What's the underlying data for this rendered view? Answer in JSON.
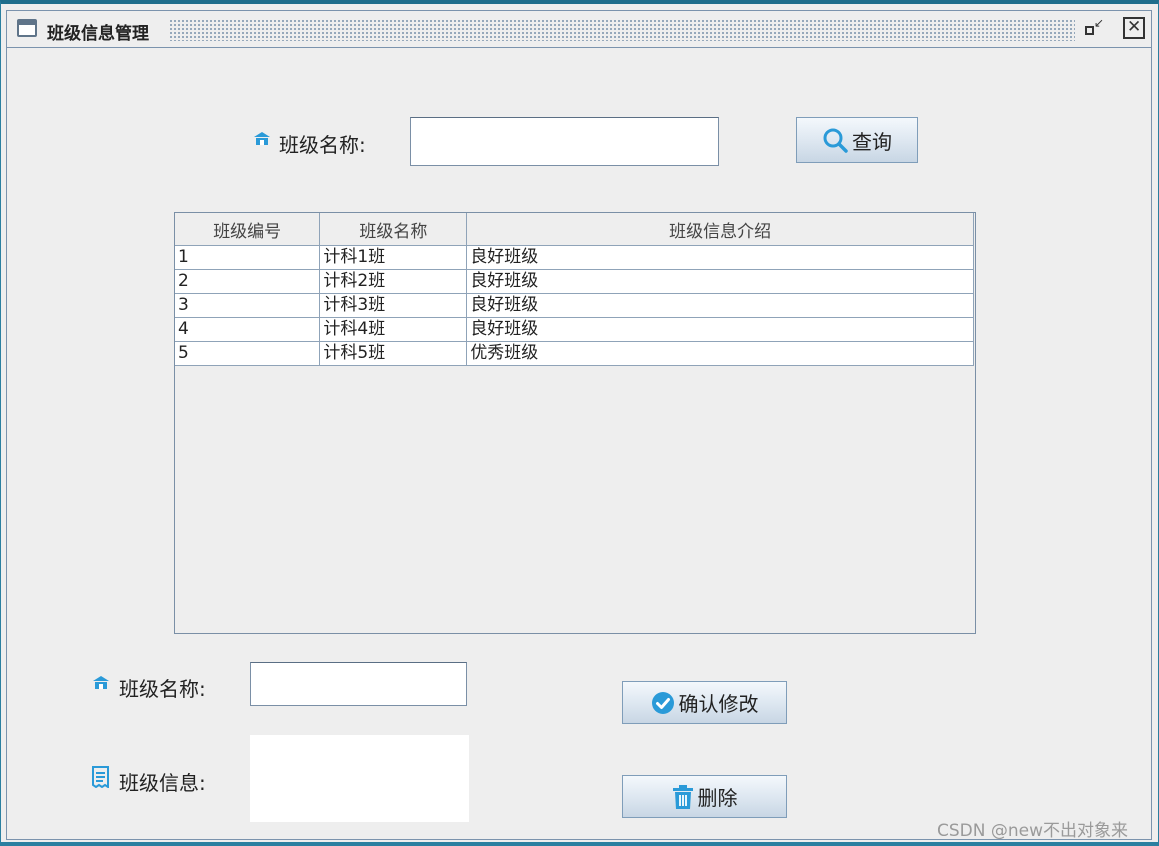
{
  "window": {
    "title": "班级信息管理",
    "restore_icon": "restore-icon",
    "close_icon": "close-icon"
  },
  "search": {
    "label": "班级名称:",
    "icon": "building-icon",
    "value": "",
    "button_label": "查询",
    "button_icon": "search-icon"
  },
  "table": {
    "columns": [
      "班级编号",
      "班级名称",
      "班级信息介绍"
    ],
    "rows": [
      [
        "1",
        "计科1班",
        "良好班级"
      ],
      [
        "2",
        "计科2班",
        "良好班级"
      ],
      [
        "3",
        "计科3班",
        "良好班级"
      ],
      [
        "4",
        "计科4班",
        "良好班级"
      ],
      [
        "5",
        "计科5班",
        "优秀班级"
      ]
    ]
  },
  "edit": {
    "name_label": "班级名称:",
    "name_icon": "building-icon",
    "name_value": "",
    "info_label": "班级信息:",
    "info_icon": "document-icon",
    "info_value": "",
    "confirm_label": "确认修改",
    "confirm_icon": "check-circle-icon",
    "delete_label": "删除",
    "delete_icon": "trash-icon"
  },
  "watermark": "CSDN @new不出对象来",
  "colors": {
    "accent_blue": "#2a9ad8",
    "frame_teal": "#1f6e8c"
  }
}
